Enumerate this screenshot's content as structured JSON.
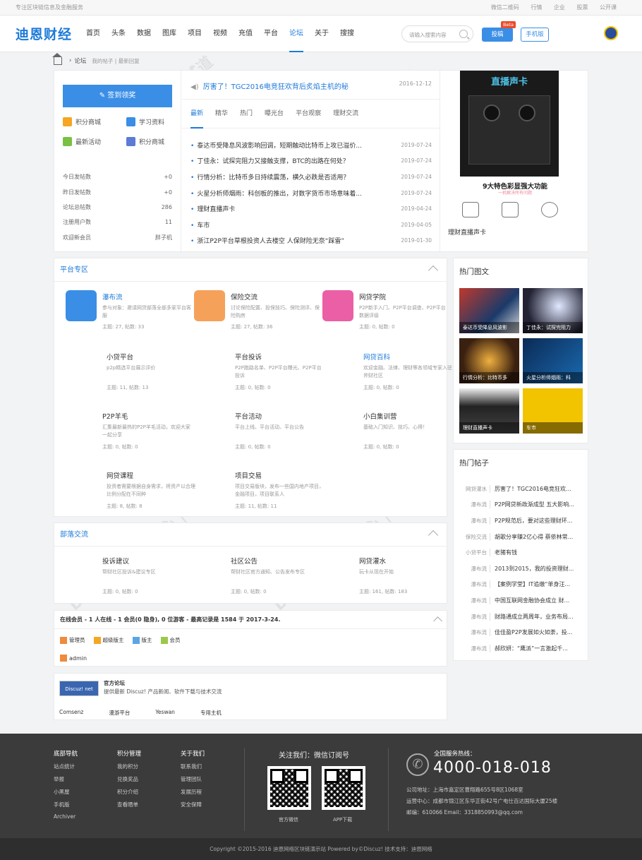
{
  "topbar": {
    "tagline": "专注区块链信息及金融服务",
    "links": [
      "微信二维码",
      "行情",
      "企业",
      "股票",
      "公开课"
    ]
  },
  "header": {
    "logo": "迪恩财经",
    "nav": [
      "首页",
      "头条",
      "数据",
      "图库",
      "项目",
      "视频",
      "充值",
      "平台",
      "论坛",
      "关于",
      "搜搜"
    ],
    "active_nav": "论坛",
    "search_placeholder": "请输入搜索内容",
    "invest_label": "投稿",
    "beta": "Beta",
    "mobile_label": "手机版"
  },
  "breadcrumb": {
    "current": "论坛",
    "sub": "我的帖子 | 最新回复"
  },
  "left": {
    "signin": "签到领奖",
    "quick": [
      "积分商城",
      "学习资料",
      "最新活动",
      "积分商城"
    ],
    "stats": [
      {
        "label": "今日发帖数",
        "value": "+0"
      },
      {
        "label": "昨日发帖数",
        "value": "+0"
      },
      {
        "label": "论坛总帖数",
        "value": "286"
      },
      {
        "label": "注册用户数",
        "value": "11"
      },
      {
        "label": "欢迎新会员",
        "value": "胖子机"
      }
    ]
  },
  "center": {
    "headline": "厉害了！TGC2016电竞狂欢背后炙焰主机的秘",
    "headline_date": "2016-12-12",
    "tabs": [
      "最新",
      "精华",
      "热门",
      "曝光台",
      "平台观察",
      "理财交流"
    ],
    "news": [
      {
        "title": "泰达币受降息风波影响回调，短期触动比特币上攻已溢价...",
        "date": "2019-07-24"
      },
      {
        "title": "丁佳永：试探完阻力又接触支撑，BTC的出路在何处？",
        "date": "2019-07-24"
      },
      {
        "title": "行情分析：比特币多日持续震荡，横久必跌是否适用？",
        "date": "2019-07-24"
      },
      {
        "title": "火星分析师烟雨：科创板的推出，对数字货币市场意味着...",
        "date": "2019-07-24"
      },
      {
        "title": "理财直播声卡",
        "date": "2019-04-24"
      },
      {
        "title": "车市",
        "date": "2019-04-05"
      },
      {
        "title": "浙江P2P平台草根投资人去楼空 人保财险无奈“踩雷”",
        "date": "2019-01-30"
      }
    ]
  },
  "promo": {
    "title": "直播声卡",
    "caption": "9大特色彩显强大功能",
    "sub": "一机解决所有问题",
    "label": "理财直播声卡"
  },
  "platform": {
    "title": "平台专区",
    "forums": [
      {
        "name": "瀑布流",
        "desc": "参与对象：邀请网贷部落全部多家平台客服",
        "stat": "主题: 27, 帖数: 33"
      },
      {
        "name": "保险交流",
        "desc": "讨论保险配置、投保技巧、保险测评、保险购房",
        "stat": "主题: 27, 帖数: 36"
      },
      {
        "name": "网贷学院",
        "desc": "P2P新手入门、P2P平台调查、P2P平台数据评级",
        "stat": "主题: 0, 帖数: 0"
      },
      {
        "name": "小贷平台",
        "desc": "p2p精选平台展示评价",
        "stat": "主题: 11, 帖数: 13"
      },
      {
        "name": "平台投诉",
        "desc": "P2P跑路名单、P2P平台曝光、P2P平台投诉",
        "stat": "主题: 0, 帖数: 0"
      },
      {
        "name": "网贷百科",
        "desc": "欢迎金融、法律、理财等各领域专家入驻斧财社区",
        "stat": "主题: 0, 帖数: 0"
      },
      {
        "name": "P2P羊毛",
        "desc": "汇集最新最热的P2P羊毛活动，欢迎大家一起分享",
        "stat": "主题: 0, 帖数: 0"
      },
      {
        "name": "平台活动",
        "desc": "平台上线、平台活动、平台公告",
        "stat": "主题: 0, 帖数: 0"
      },
      {
        "name": "小白集训营",
        "desc": "基础入门知识、技巧、心得！",
        "stat": "主题: 0, 帖数: 0"
      },
      {
        "name": "网贷课程",
        "desc": "投资者需要根据自身需求，将资产以合理比例分配在不同种",
        "stat": "主题: 8, 帖数: 8"
      },
      {
        "name": "项目交易",
        "desc": "项目交易版块，发布一些国内地产项目，金融项目，项目联系人",
        "stat": "主题: 11, 帖数: 11"
      }
    ]
  },
  "tribe": {
    "title": "部落交流",
    "forums": [
      {
        "name": "投诉建议",
        "desc": "帮财社区投诉&建议专区",
        "stat": "主题: 0, 帖数: 0"
      },
      {
        "name": "社区公告",
        "desc": "帮财社区官方通知、公告发布专区",
        "stat": "主题: 0, 帖数: 0"
      },
      {
        "name": "网贷灌水",
        "desc": "玩卡从现在开始",
        "stat": "主题: 161, 帖数: 183"
      }
    ]
  },
  "online": {
    "summary": "在线会员 - 1 人在线 - 1 会员(0 隐身), 0 位游客 - 最高记录是 1584 于 2017-3-24.",
    "legend": [
      "管理员",
      "超级版主",
      "版主",
      "会员"
    ],
    "user": "admin"
  },
  "partner": {
    "logo": "Discuz! net",
    "title": "官方论坛",
    "desc": "提供最新 Discuz! 产品新闻、软件下载与技术交流",
    "links": [
      "Comsenz",
      "漫游平台",
      "Yeswan",
      "专用主机"
    ]
  },
  "hot_pics": {
    "title": "热门图文",
    "items": [
      "泰达币受降息风波影",
      "丁佳永：试探完阻力",
      "行情分析：比特币多",
      "火星分析师烟雨：科",
      "理财直播声卡",
      "车市"
    ]
  },
  "hot_posts": {
    "title": "热门帖子",
    "items": [
      {
        "cat": "网贷灌水",
        "title": "厉害了！TGC2016电竞狂欢..."
      },
      {
        "cat": "瀑布流",
        "title": "P2P网贷新政渐成型 五大影响..."
      },
      {
        "cat": "瀑布流",
        "title": "P2P规范后，要对这些理财环..."
      },
      {
        "cat": "保险交流",
        "title": "胡歌分享赚2亿心得 蔡依林常..."
      },
      {
        "cat": "小贷平台",
        "title": "老猪有钱"
      },
      {
        "cat": "瀑布流",
        "title": "2013到2015，我的投资理财..."
      },
      {
        "cat": "瀑布流",
        "title": "【案例学堂】IT追缴“单身汪..."
      },
      {
        "cat": "瀑布流",
        "title": "中国互联网金融协会成立 财..."
      },
      {
        "cat": "瀑布流",
        "title": "财路通成立两周年，业务布局..."
      },
      {
        "cat": "瀑布流",
        "title": "佳佳盈P2P发展如火如荼，投..."
      },
      {
        "cat": "瀑布流",
        "title": "郝欣妍：“鹰派”一言激起千..."
      }
    ]
  },
  "footer": {
    "cols": [
      {
        "title": "底部导航",
        "items": [
          "站点统计",
          "举报",
          "小黑屋",
          "手机版",
          "Archiver"
        ]
      },
      {
        "title": "积分管理",
        "items": [
          "我的积分",
          "兑换奖品",
          "积分介绍",
          "查看晒单"
        ]
      },
      {
        "title": "关于我们",
        "items": [
          "联系我们",
          "管理团队",
          "发展历程",
          "安全保障"
        ]
      }
    ],
    "follow": "关注我们：微信订阅号",
    "qr_labels": [
      "官方微信",
      "APP下载"
    ],
    "hotline_label": "全国服务热线：",
    "phone": "4000-018-018",
    "address": "公司地址：上海市嘉定区曹翔路655号8区1068室",
    "ops": "运营中心：成都市锦江区东华正街42号广电仕百达国际大厦25楼",
    "email": "邮编：610066 Email：3318850993@qq.com",
    "copyright": "Copyright  ©2015-2016  迪恩网络区块链演示站  Powered by©Discuz!  技术支持：迪恩网络"
  },
  "colors": {
    "accent": "#1e7ad9",
    "footer": "#3b3b3b"
  }
}
